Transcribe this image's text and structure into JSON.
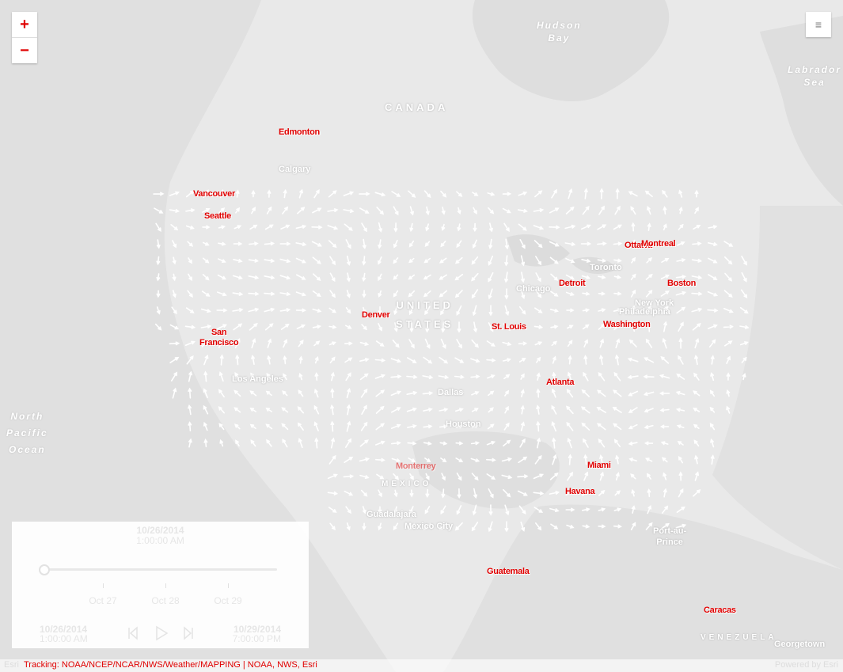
{
  "map": {
    "water_labels": {
      "hudson_bay": "Hudson\nBay",
      "labrador_sea": "Labrador\nSea",
      "north_pacific": "North\nPacific\nOcean"
    },
    "region_labels": {
      "canada": "CANADA",
      "united_states": "UNITED\nSTATES",
      "mexico": "MEXICO",
      "venezuela": "VENEZUELA"
    },
    "cities_red": {
      "edmonton": "Edmonton",
      "vancouver": "Vancouver",
      "seattle": "Seattle",
      "ottawa": "Ottawa",
      "montreal": "Montreal",
      "detroit": "Detroit",
      "boston": "Boston",
      "denver": "Denver",
      "st_louis": "St. Louis",
      "washington": "Washington",
      "san_francisco": "San\nFrancisco",
      "atlanta": "Atlanta",
      "miami": "Miami",
      "havana": "Havana",
      "guatemala": "Guatemala",
      "caracas": "Caracas",
      "monterrey": "Monterrey"
    },
    "cities_gray": {
      "calgary": "Calgary",
      "toronto": "Toronto",
      "chicago": "Chicago",
      "new_york": "New York",
      "philadelphia": "Philadelphia",
      "los_angeles": "Los Angeles",
      "dallas": "Dallas",
      "houston": "Houston",
      "guadalajara": "Guadalajara",
      "mexico_city": "Mexico City",
      "port_au_prince": "Port-au-\nPrince",
      "georgetown": "Georgetown"
    }
  },
  "zoom": {
    "in_icon": "+",
    "out_icon": "−"
  },
  "menu": {
    "icon": "≡"
  },
  "time_slider": {
    "current_date": "10/26/2014",
    "current_time": "1:00:00 AM",
    "position": 0,
    "ticks": [
      "Oct 27",
      "Oct 28",
      "Oct 29"
    ],
    "start_date": "10/26/2014",
    "start_time": "1:00:00 AM",
    "end_date": "10/29/2014",
    "end_time": "7:00:00 PM"
  },
  "attribution": {
    "esri_prefix": "Esri",
    "text": "Tracking: NOAA/NCEP/NCAR/NWS/Weather/MAPPING | NOAA, NWS, Esri",
    "powered": "Powered by Esri"
  },
  "colors": {
    "accent": "#e00000",
    "arrows": "#ffffff",
    "land": "#e6e6e6"
  }
}
